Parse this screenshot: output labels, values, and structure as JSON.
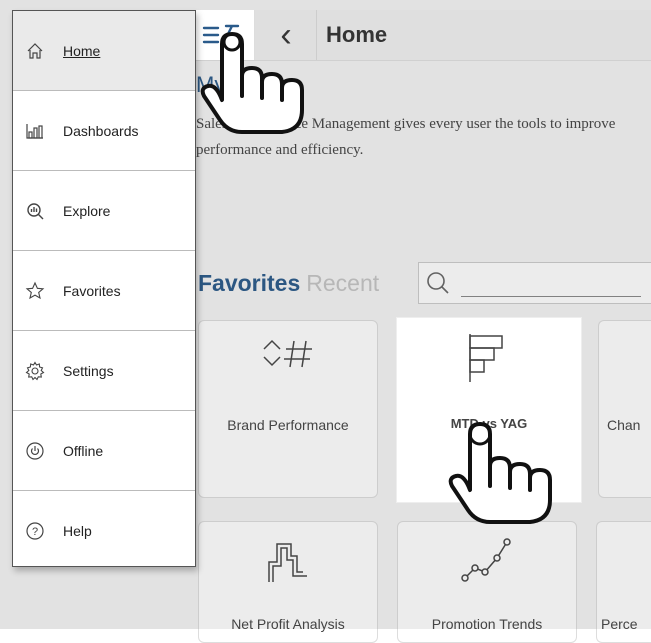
{
  "sidebar": {
    "items": [
      {
        "label": "Home",
        "icon": "home-icon",
        "active": true
      },
      {
        "label": "Dashboards",
        "icon": "bar-chart-icon",
        "active": false
      },
      {
        "label": "Explore",
        "icon": "explore-icon",
        "active": false
      },
      {
        "label": "Favorites",
        "icon": "star-icon",
        "active": false
      },
      {
        "label": "Settings",
        "icon": "gear-icon",
        "active": false
      },
      {
        "label": "Offline",
        "icon": "power-icon",
        "active": false
      },
      {
        "label": "Help",
        "icon": "help-icon",
        "active": false
      }
    ]
  },
  "header": {
    "title": "Home",
    "menu_icon": "hamburger-icon",
    "back_icon": "chevron-left-icon"
  },
  "main": {
    "section_title": "My Stories",
    "intro_text": "Sales Performance Management gives every user the tools to improve performance and efficiency.",
    "tabs": [
      {
        "label": "Favorites",
        "active": true
      },
      {
        "label": "Recent",
        "active": false
      }
    ],
    "search": {
      "value": "",
      "placeholder": ""
    },
    "cards": [
      {
        "label": "Brand Performance",
        "icon": "kpi-number-icon"
      },
      {
        "label": "MTD vs YAG",
        "icon": "horizontal-bar-icon",
        "highlighted": true
      },
      {
        "label": "Chan",
        "icon": "chart-icon"
      },
      {
        "label": "Net Profit Analysis",
        "icon": "step-chart-icon"
      },
      {
        "label": "Promotion Trends",
        "icon": "line-chart-icon"
      },
      {
        "label": "Perce",
        "icon": "chart-icon"
      }
    ]
  },
  "colors": {
    "accent": "#2a5a8a",
    "muted_tab": "#c4c4c4",
    "active_nav_bg": "#eaeaea"
  },
  "overlay": {
    "gesture": "tap",
    "cursor_icon": "hand-pointer-icon"
  }
}
